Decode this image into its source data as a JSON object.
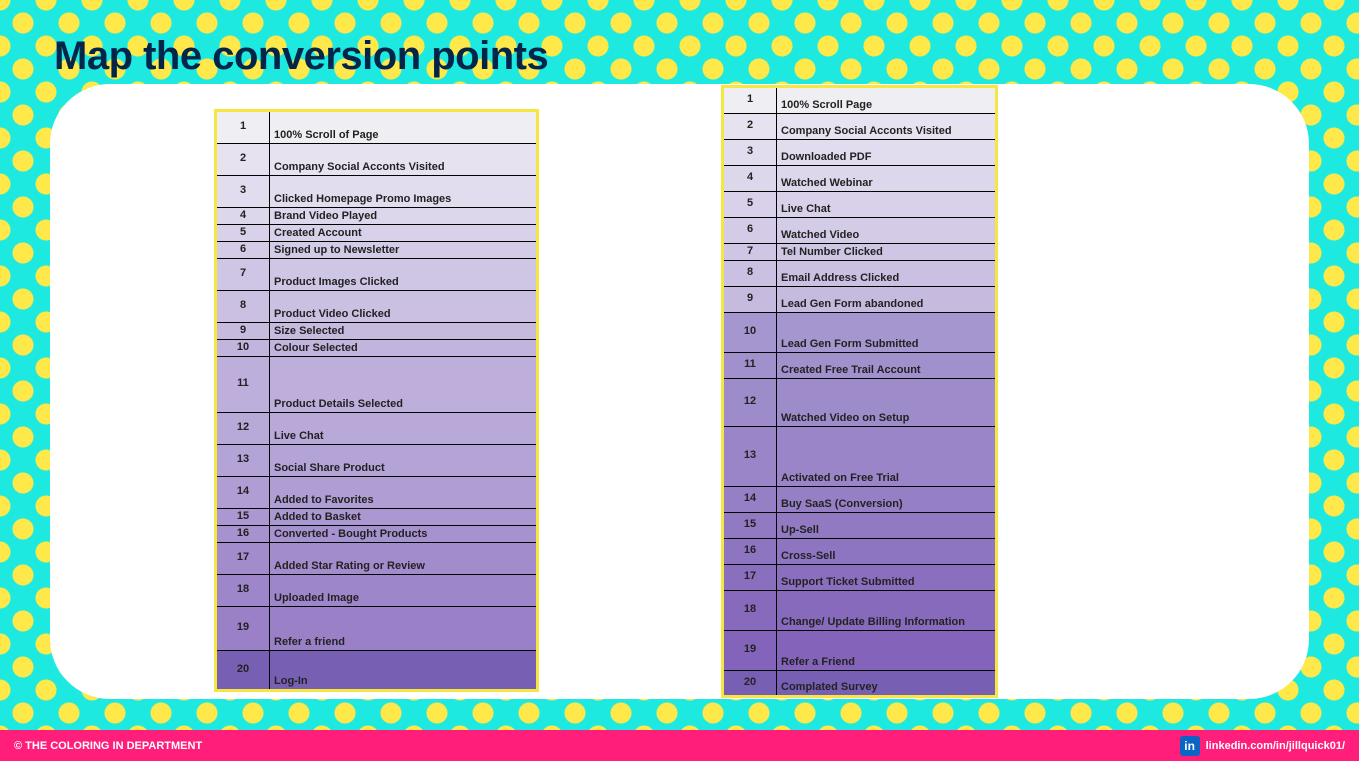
{
  "title": "Map the conversion points",
  "footer": {
    "copyright": "© THE COLORING IN DEPARTMENT",
    "linkedin": "linkedin.com/in/jillquick01/"
  },
  "table1": [
    {
      "n": 1,
      "t": "100% Scroll of Page",
      "h": 32,
      "c": "#efeef3"
    },
    {
      "n": 2,
      "t": "Company Social Acconts Visited",
      "h": 32,
      "c": "#e6e2f0"
    },
    {
      "n": 3,
      "t": "Clicked Homepage Promo Images",
      "h": 32,
      "c": "#e1dcee"
    },
    {
      "n": 4,
      "t": "Brand Video Played",
      "h": 17,
      "c": "#ddd7ec"
    },
    {
      "n": 5,
      "t": "Created Account",
      "h": 17,
      "c": "#d8d1e9"
    },
    {
      "n": 6,
      "t": "Signed up to Newsletter",
      "h": 17,
      "c": "#d4cbe7"
    },
    {
      "n": 7,
      "t": "Product Images Clicked",
      "h": 32,
      "c": "#cfc5e4"
    },
    {
      "n": 8,
      "t": "Product Video Clicked",
      "h": 32,
      "c": "#cbc0e2"
    },
    {
      "n": 9,
      "t": "Size Selected",
      "h": 17,
      "c": "#c6badf"
    },
    {
      "n": 10,
      "t": "Colour Selected",
      "h": 17,
      "c": "#c2b4dd"
    },
    {
      "n": 11,
      "t": "Product Details Selected",
      "h": 56,
      "c": "#bdaedb"
    },
    {
      "n": 12,
      "t": "Live Chat",
      "h": 32,
      "c": "#b8a9d8"
    },
    {
      "n": 13,
      "t": "Social Share Product",
      "h": 32,
      "c": "#b4a3d6"
    },
    {
      "n": 14,
      "t": "Added to Favorites",
      "h": 32,
      "c": "#af9dd3"
    },
    {
      "n": 15,
      "t": "Added to Basket",
      "h": 17,
      "c": "#ab97d1"
    },
    {
      "n": 16,
      "t": "Converted - Bought Products",
      "h": 17,
      "c": "#a692ce"
    },
    {
      "n": 17,
      "t": "Added Star Rating or Review",
      "h": 32,
      "c": "#a28ccc"
    },
    {
      "n": 18,
      "t": "Uploaded Image",
      "h": 32,
      "c": "#9d86c9"
    },
    {
      "n": 19,
      "t": "Refer a friend",
      "h": 44,
      "c": "#9980c7"
    },
    {
      "n": 20,
      "t": "Log-In",
      "h": 40,
      "c": "#7760b3"
    }
  ],
  "table2": [
    {
      "n": 1,
      "t": "100% Scroll Page",
      "h": 26,
      "c": "#efeef3"
    },
    {
      "n": 2,
      "t": "Company Social Acconts Visited",
      "h": 26,
      "c": "#e6e2f0"
    },
    {
      "n": 3,
      "t": "Downloaded PDF",
      "h": 26,
      "c": "#e1dcee"
    },
    {
      "n": 4,
      "t": "Watched Webinar",
      "h": 26,
      "c": "#ddd7ec"
    },
    {
      "n": 5,
      "t": "Live Chat",
      "h": 26,
      "c": "#d8d1e9"
    },
    {
      "n": 6,
      "t": "Watched Video",
      "h": 26,
      "c": "#d4cbe7"
    },
    {
      "n": 7,
      "t": "Tel Number Clicked",
      "h": 17,
      "c": "#cfc5e4"
    },
    {
      "n": 8,
      "t": "Email Address Clicked",
      "h": 26,
      "c": "#cbc0e2"
    },
    {
      "n": 9,
      "t": "Lead Gen Form abandoned",
      "h": 26,
      "c": "#c6badf"
    },
    {
      "n": 10,
      "t": "Lead Gen Form Submitted",
      "h": 40,
      "c": "#a596cf"
    },
    {
      "n": 11,
      "t": "Created Free Trail Account",
      "h": 26,
      "c": "#a290cc"
    },
    {
      "n": 12,
      "t": "Watched Video on Setup",
      "h": 48,
      "c": "#9e8bca"
    },
    {
      "n": 13,
      "t": "Activated on Free Trial",
      "h": 60,
      "c": "#9a85c8"
    },
    {
      "n": 14,
      "t": "Buy SaaS (Conversion)",
      "h": 26,
      "c": "#9680c5"
    },
    {
      "n": 15,
      "t": "Up-Sell",
      "h": 26,
      "c": "#927ac3"
    },
    {
      "n": 16,
      "t": "Cross-Sell",
      "h": 26,
      "c": "#8e75c1"
    },
    {
      "n": 17,
      "t": "Support Ticket Submitted",
      "h": 26,
      "c": "#8b6fbf"
    },
    {
      "n": 18,
      "t": "Change/ Update  Billing Information",
      "h": 40,
      "c": "#876abc"
    },
    {
      "n": 19,
      "t": "Refer a Friend",
      "h": 40,
      "c": "#8364ba"
    },
    {
      "n": 20,
      "t": "Complated Survey",
      "h": 26,
      "c": "#7760b3"
    }
  ]
}
